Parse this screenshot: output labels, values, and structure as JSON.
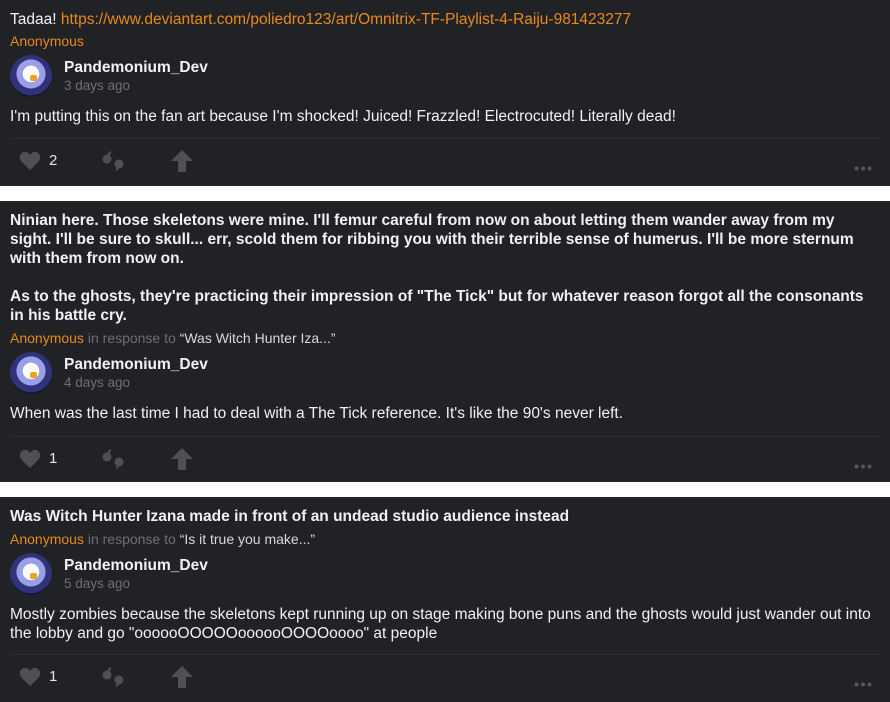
{
  "posts": [
    {
      "question_prefix": "Tadaa! ",
      "question_link": "https://www.deviantart.com/poliedro123/art/Omnitrix-TF-Playlist-4-Raiju-981423277",
      "asker": "Anonymous",
      "author": "Pandemonium_Dev",
      "time": "3 days ago",
      "answer": "I'm putting this on the fan art because I'm shocked! Juiced! Frazzled! Electrocuted! Literally dead!",
      "likes": "2"
    },
    {
      "question_p1": "Ninian here. Those skeletons were mine. I'll femur careful from now on about letting them wander away from my sight. I'll be sure to skull... err, scold them for ribbing you with their terrible sense of humerus. I'll be more sternum with them from now on.",
      "question_p2": "As to the ghosts, they're practicing their impression of \"The Tick\" but for whatever reason forgot all the consonants in his battle cry.",
      "asker": "Anonymous",
      "in_response": "in response to",
      "quote": "“Was Witch Hunter Iza...”",
      "author": "Pandemonium_Dev",
      "time": "4 days ago",
      "answer": "When was the last time I had to deal with a The Tick reference. It's like the 90's never left.",
      "likes": "1"
    },
    {
      "question": "Was Witch Hunter Izana made in front of an undead studio audience instead",
      "asker": "Anonymous",
      "in_response": "in response to",
      "quote": "“Is it true you make...”",
      "author": "Pandemonium_Dev",
      "time": "5 days ago",
      "answer": "Mostly zombies because the skeletons kept running up on stage making bone puns and the ghosts would just wander out into the lobby and go \"oooooOOOOOoooooOOOOoooo\" at people",
      "likes": "1"
    }
  ],
  "icons": {
    "like": "heart-icon",
    "repost": "quote-icon",
    "share": "share-arrow-icon",
    "more": "more-dots-icon"
  }
}
